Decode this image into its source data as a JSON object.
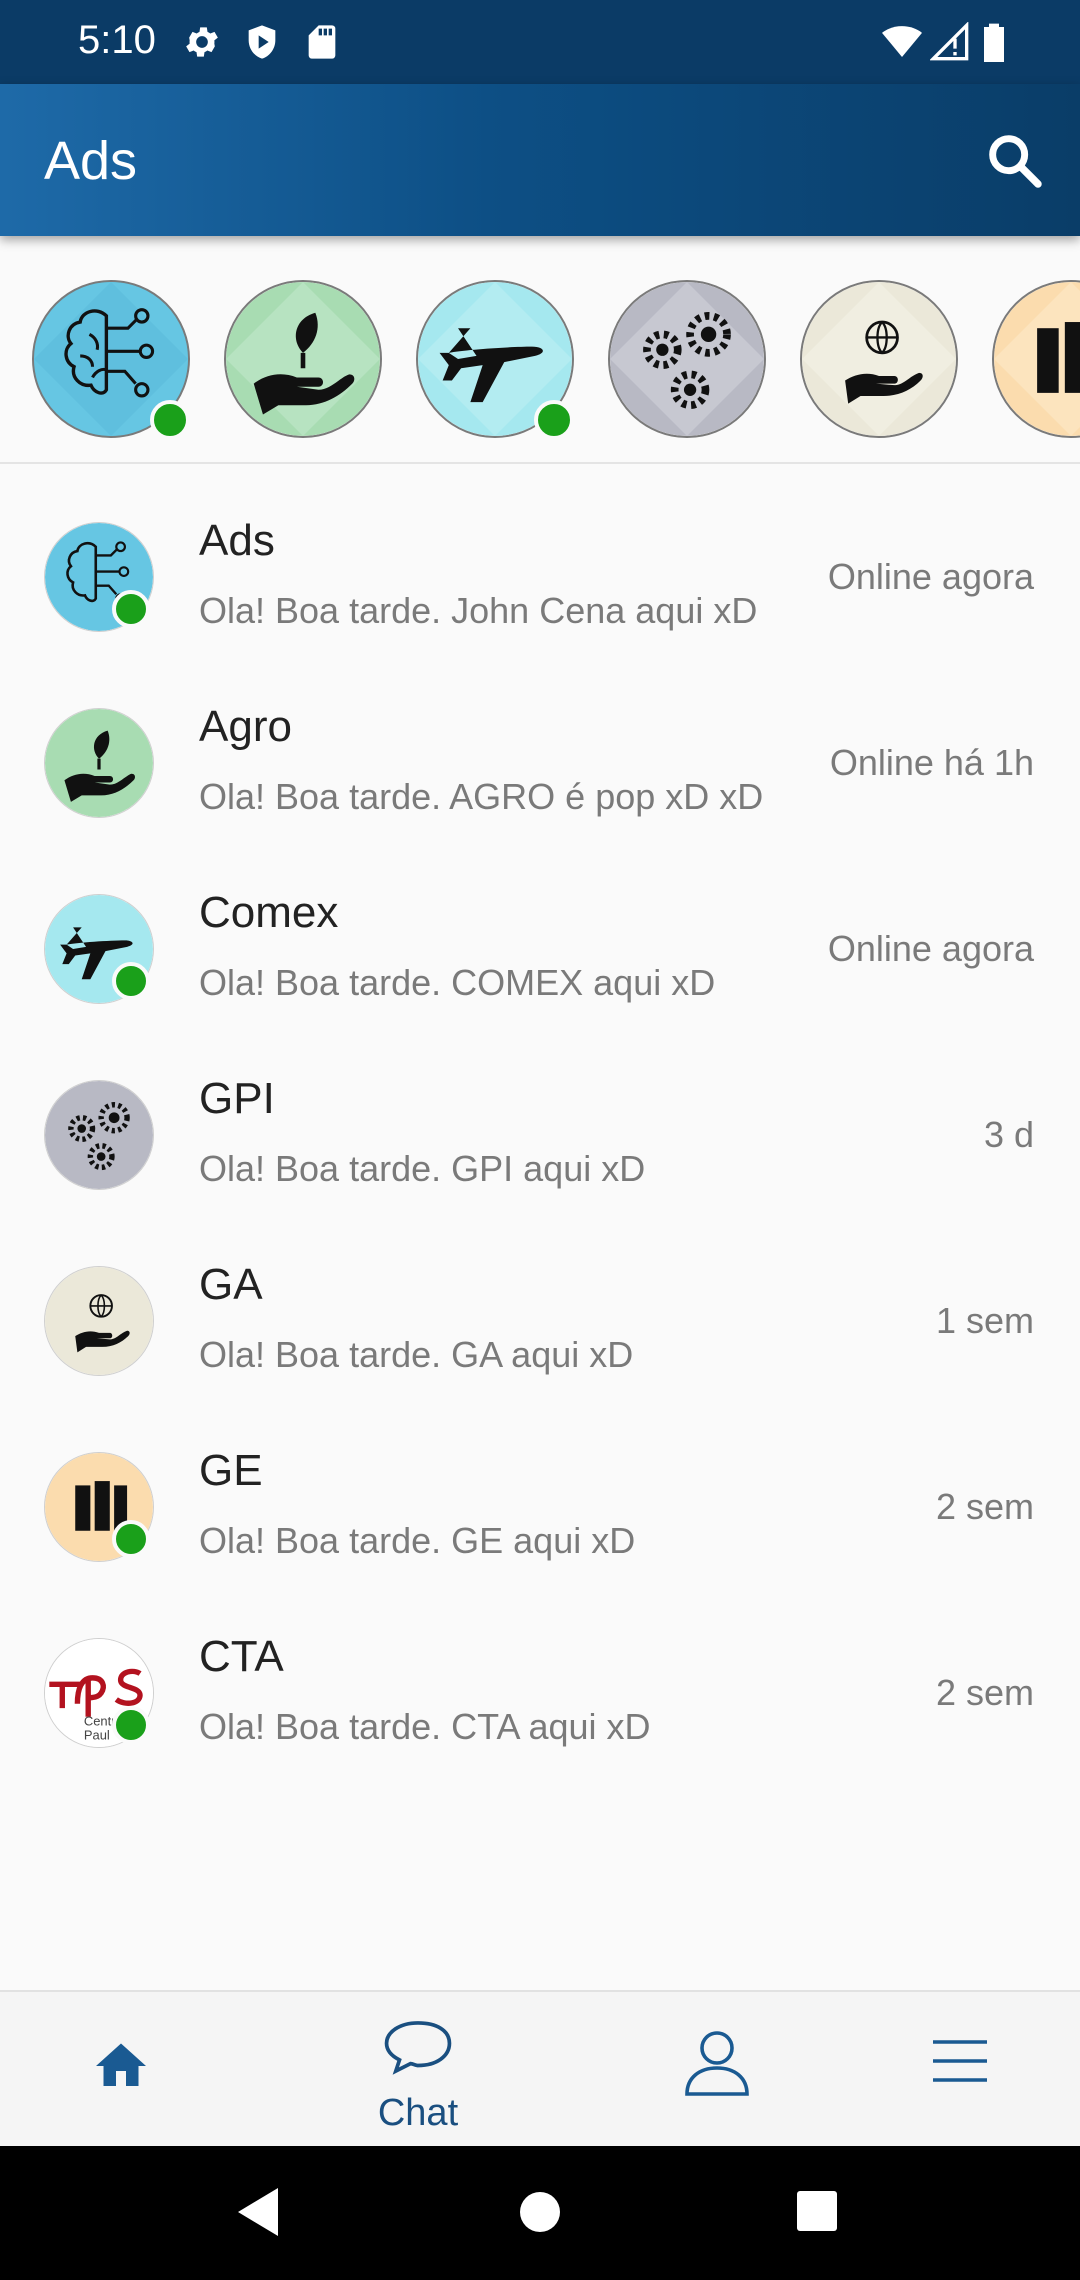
{
  "status_bar": {
    "time": "5:10",
    "left_icons": [
      "settings-gear-icon",
      "shield-icon",
      "sd-card-icon"
    ],
    "right_icons": [
      "wifi-icon",
      "signal-icon",
      "battery-icon"
    ]
  },
  "app_bar": {
    "title": "Ads",
    "search_icon": "search-icon"
  },
  "stories": [
    {
      "id": "ads",
      "icon": "brain-circuit-icon",
      "online": true
    },
    {
      "id": "agro",
      "icon": "plant-hand-icon",
      "online": false
    },
    {
      "id": "comex",
      "icon": "airplane-icon",
      "online": true
    },
    {
      "id": "gpi",
      "icon": "gears-icon",
      "online": false
    },
    {
      "id": "ga",
      "icon": "globe-hand-icon",
      "online": false
    },
    {
      "id": "ge",
      "icon": "building-icon",
      "online": false
    }
  ],
  "chats": [
    {
      "name": "Ads",
      "preview": "Ola! Boa tarde. John Cena aqui xD",
      "meta": "Online agora",
      "online": true
    },
    {
      "name": "Agro",
      "preview": "Ola! Boa tarde. AGRO é pop xD xD",
      "meta": "Online há 1h",
      "online": false
    },
    {
      "name": "Comex",
      "preview": "Ola! Boa tarde. COMEX aqui xD",
      "meta": "Online agora",
      "online": true
    },
    {
      "name": "GPI",
      "preview": "Ola! Boa tarde. GPI aqui xD",
      "meta": "3 d",
      "online": false
    },
    {
      "name": "GA",
      "preview": "Ola! Boa tarde. GA aqui xD",
      "meta": "1 sem",
      "online": false
    },
    {
      "name": "GE",
      "preview": "Ola! Boa tarde. GE aqui xD",
      "meta": "2 sem",
      "online": true
    },
    {
      "name": "CTA",
      "preview": "Ola! Boa tarde. CTA aqui xD",
      "meta": "2 sem",
      "online": true,
      "logo_text": [
        "Centr",
        "Paul"
      ]
    }
  ],
  "bottom_nav": {
    "items": [
      {
        "id": "home",
        "icon": "home-icon",
        "label": ""
      },
      {
        "id": "chat",
        "icon": "chat-bubble-icon",
        "label": "Chat"
      },
      {
        "id": "profile",
        "icon": "person-icon",
        "label": ""
      },
      {
        "id": "menu",
        "icon": "hamburger-menu-icon",
        "label": ""
      }
    ],
    "active": "chat"
  },
  "system_nav": [
    "back-icon",
    "home-circle-icon",
    "recents-icon"
  ],
  "colors": {
    "app_bar": "#0d4f85",
    "accent": "#1a4f80",
    "online_dot": "#1aa01a"
  }
}
